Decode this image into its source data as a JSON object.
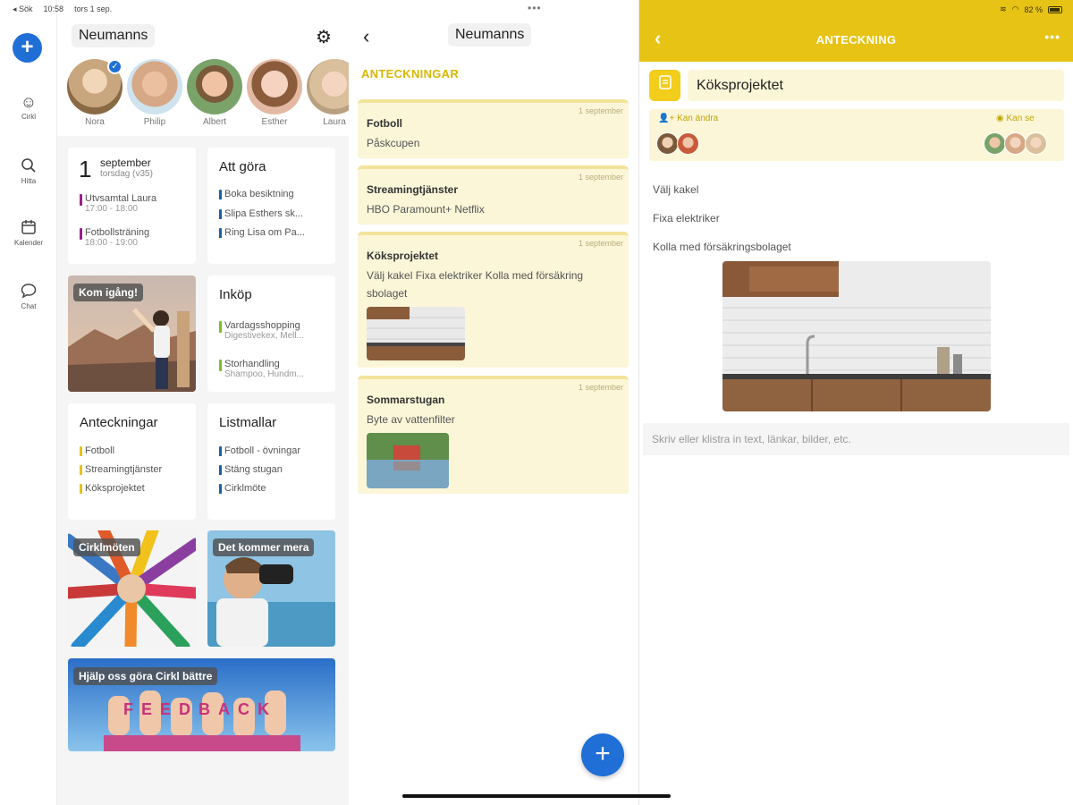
{
  "status_bar": {
    "back_app": "◂ Sök",
    "time": "10:58",
    "date": "tors 1 sep.",
    "battery": "82 %"
  },
  "rail": {
    "items": [
      {
        "label": "Cirkl",
        "icon": "smiley-icon"
      },
      {
        "label": "Hitta",
        "icon": "search-icon"
      },
      {
        "label": "Kalender",
        "icon": "calendar-icon"
      },
      {
        "label": "Chat",
        "icon": "chat-icon"
      }
    ]
  },
  "dashboard": {
    "group_name": "Neumanns",
    "members": [
      {
        "name": "Nora",
        "color": "#c9a77e",
        "selected": true
      },
      {
        "name": "Philip",
        "color": "#d6a886"
      },
      {
        "name": "Albert",
        "color": "#7aa36a"
      },
      {
        "name": "Esther",
        "color": "#e3b9a4"
      },
      {
        "name": "Laura",
        "color": "#d9bf9b"
      }
    ],
    "calendar": {
      "day": "1",
      "month": "september",
      "weekday": "torsdag (v35)",
      "events": [
        {
          "title": "Utvsamtal Laura",
          "time": "17:00 - 18:00",
          "color": "#9b1b8f"
        },
        {
          "title": "Fotbollsträning",
          "time": "18:00 - 19:00",
          "color": "#9b1b8f"
        }
      ]
    },
    "todo": {
      "title": "Att göra",
      "items": [
        {
          "text": "Boka besiktning",
          "color": "#1b5fa8"
        },
        {
          "text": "Slipa Esthers sk...",
          "color": "#1b5fa8"
        },
        {
          "text": "Ring Lisa om Pa...",
          "color": "#1b5fa8"
        }
      ]
    },
    "get_started_label": "Kom igång!",
    "shopping": {
      "title": "Inköp",
      "items": [
        {
          "text": "Vardagsshopping",
          "sub": "Digestivekex, Mell...",
          "color": "#7cbd2a"
        },
        {
          "text": "Storhandling",
          "sub": "Shampoo, Hundm...",
          "color": "#7cbd2a"
        }
      ]
    },
    "notes": {
      "title": "Anteckningar",
      "items": [
        {
          "text": "Fotboll",
          "color": "#e8c21a"
        },
        {
          "text": "Streamingtjänster",
          "color": "#e8c21a"
        },
        {
          "text": "Köksprojektet",
          "color": "#e8c21a"
        }
      ]
    },
    "templates": {
      "title": "Listmallar",
      "items": [
        {
          "text": "Fotboll - övningar",
          "color": "#1b5fa8"
        },
        {
          "text": "Stäng stugan",
          "color": "#1b5fa8"
        },
        {
          "text": "Cirklmöte",
          "color": "#1b5fa8"
        }
      ]
    },
    "circle_meetings_label": "Cirklmöten",
    "more_coming_label": "Det kommer mera",
    "feedback_label": "Hjälp oss göra Cirkl bättre",
    "feedback_word": "FEEDBACK"
  },
  "notes_list": {
    "group_name": "Neumanns",
    "section": "ANTECKNINGAR",
    "notes": [
      {
        "title": "Fotboll",
        "body": "Påskcupen",
        "date": "1 september"
      },
      {
        "title": "Streamingtjänster",
        "body": "HBO Paramount+ Netflix",
        "date": "1 september"
      },
      {
        "title": "Köksprojektet",
        "body": "Välj kakel Fixa elektriker Kolla med försäkring sbolaget",
        "date": "1 september"
      },
      {
        "title": "Sommarstugan",
        "body": "Byte av vattenfilter",
        "date": "1 september"
      }
    ],
    "add_label": "+"
  },
  "note_detail": {
    "header": "ANTECKNING",
    "title": "Köksprojektet",
    "can_edit_label": "Kan ändra",
    "can_view_label": "Kan se",
    "lines": [
      "Välj kakel",
      "Fixa elektriker",
      "Kolla med försäkringsbolaget"
    ],
    "input_placeholder": "Skriv eller klistra in text, länkar, bilder, etc."
  },
  "colors": {
    "accent": "#e6c315",
    "primary": "#1f6fd6",
    "note_bg": "#fbf6d8"
  }
}
